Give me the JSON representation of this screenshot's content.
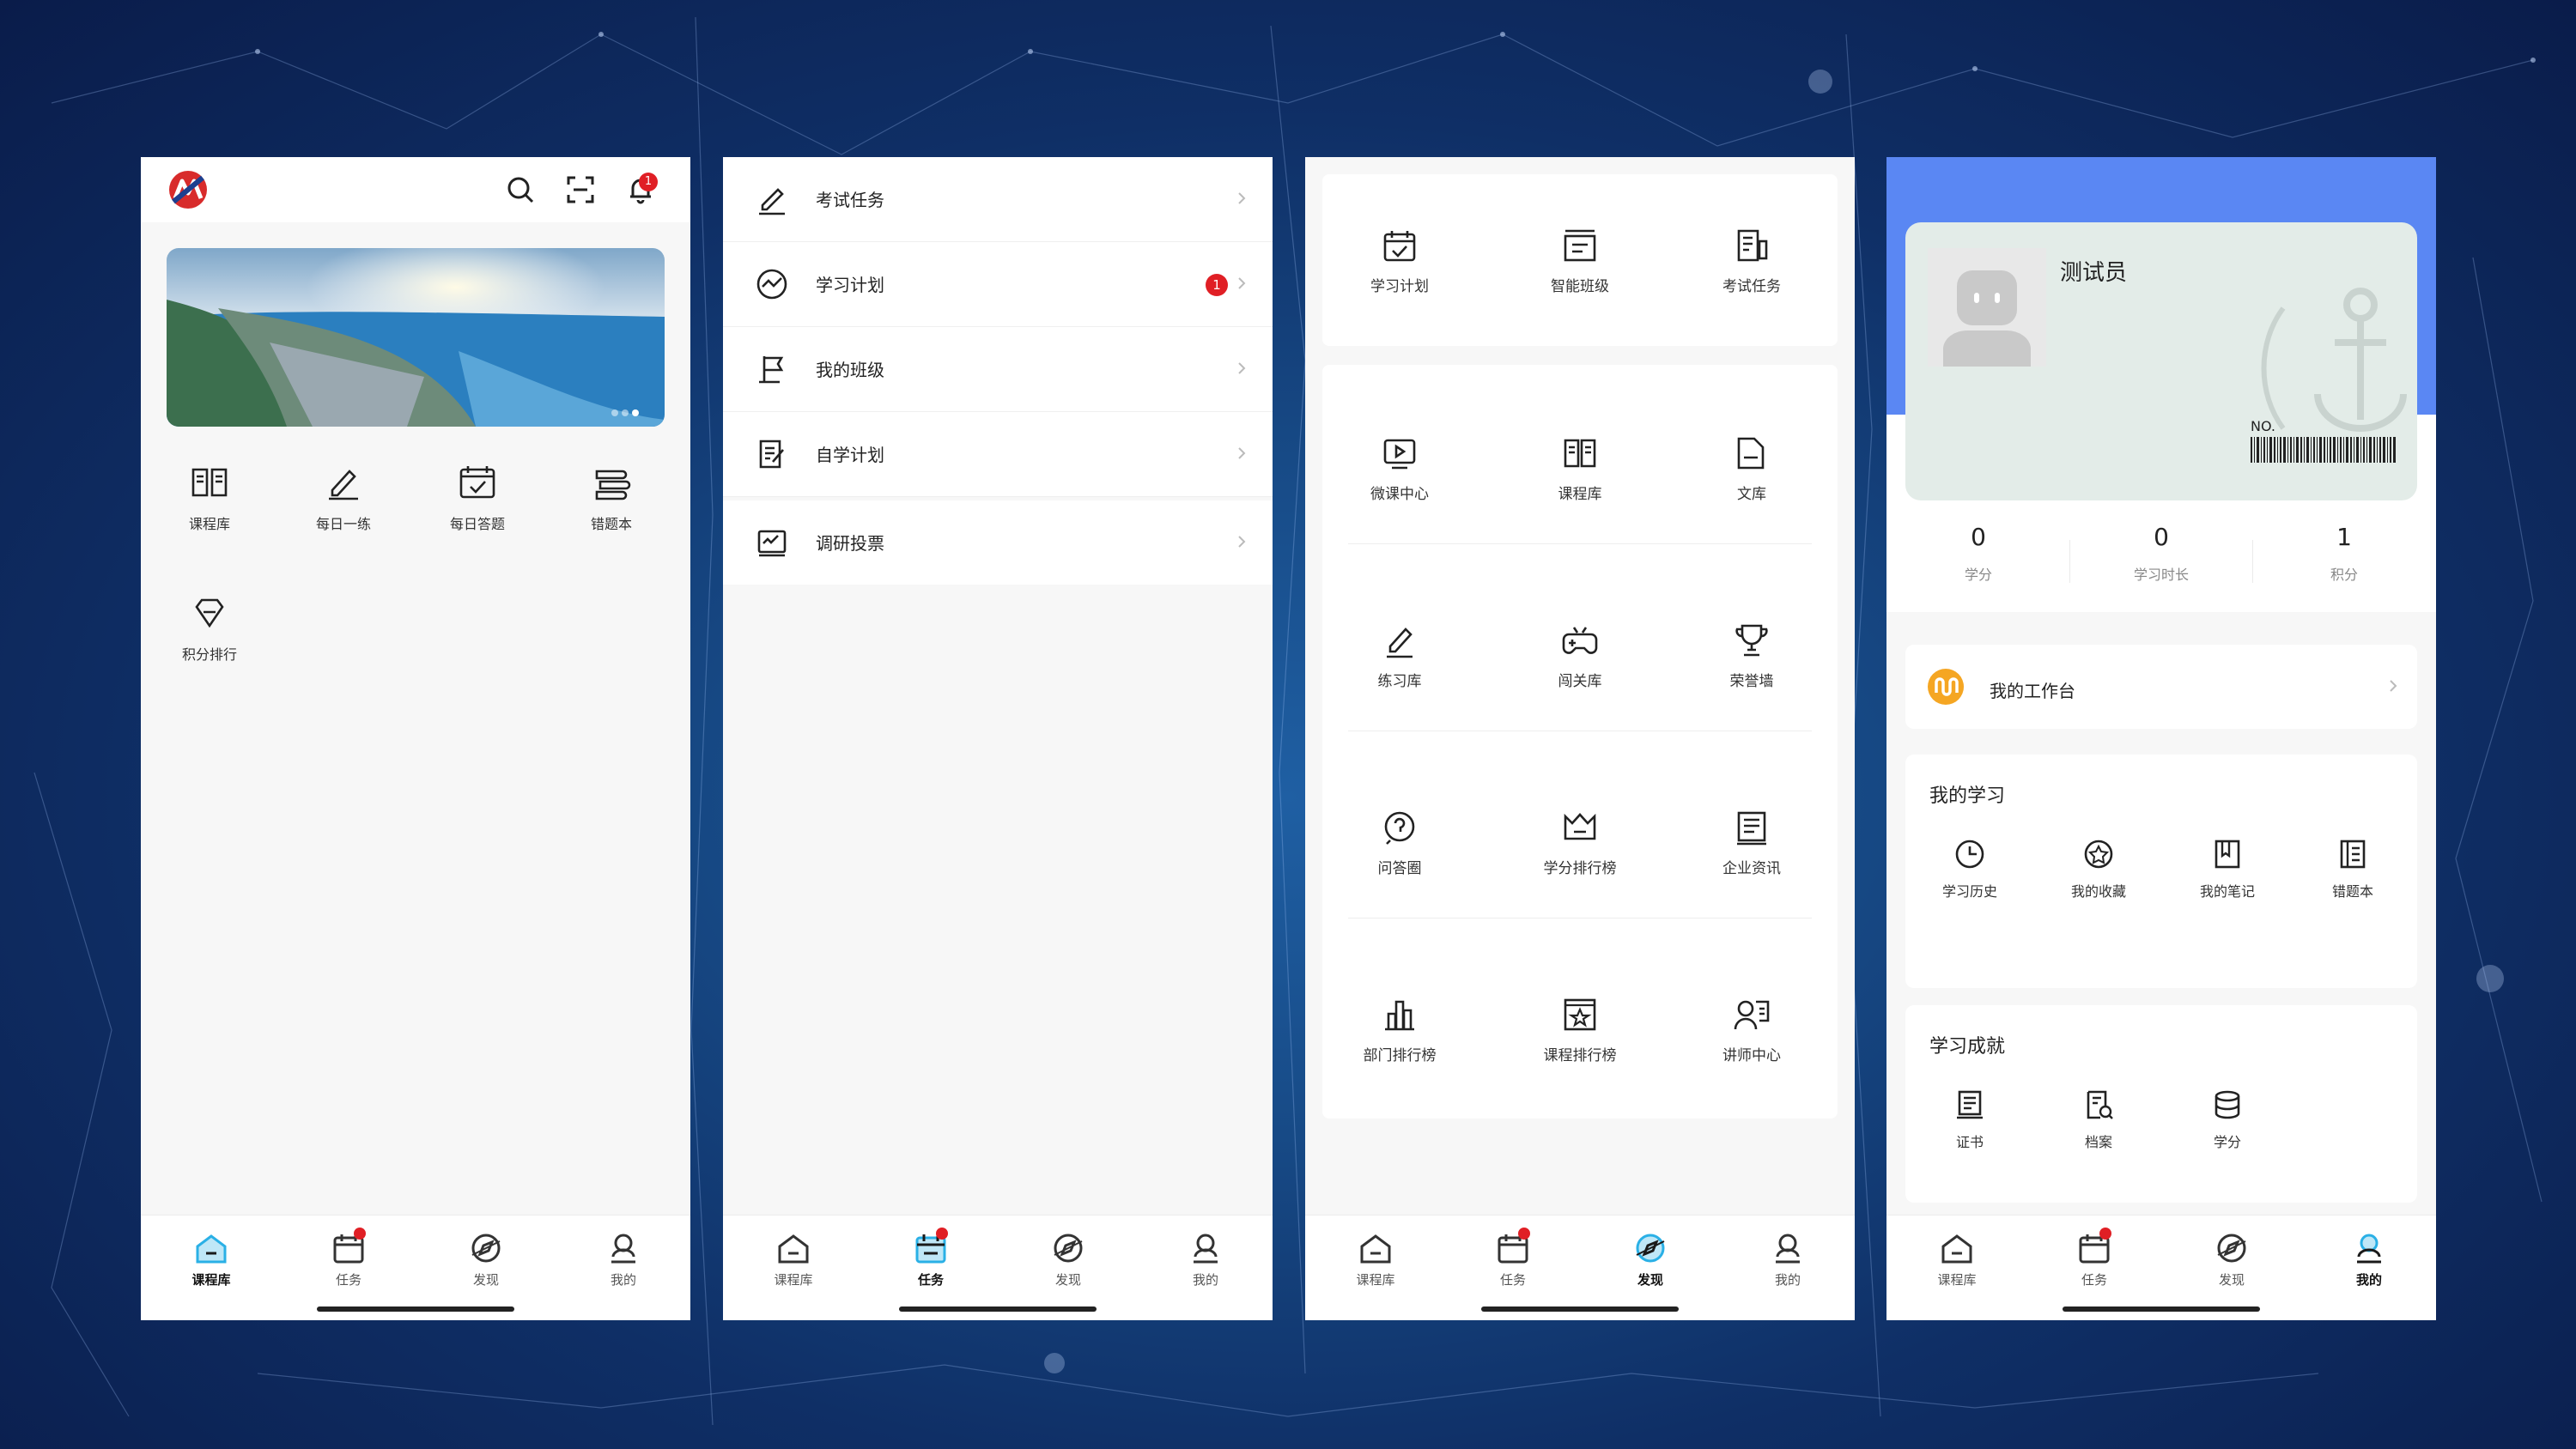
{
  "screen1": {
    "notification_count": "1",
    "grid": [
      {
        "label": "课程库",
        "icon": "book-open-icon"
      },
      {
        "label": "每日一练",
        "icon": "pencil-icon"
      },
      {
        "label": "每日答题",
        "icon": "calendar-check-icon"
      },
      {
        "label": "错题本",
        "icon": "stack-icon"
      },
      {
        "label": "积分排行",
        "icon": "diamond-icon"
      }
    ]
  },
  "screen2": {
    "items": [
      {
        "label": "考试任务",
        "icon": "pencil-icon"
      },
      {
        "label": "学习计划",
        "icon": "trend-icon",
        "badge": "1"
      },
      {
        "label": "我的班级",
        "icon": "flag-icon"
      },
      {
        "label": "自学计划",
        "icon": "document-edit-icon"
      },
      {
        "label": "调研投票",
        "icon": "survey-icon"
      }
    ]
  },
  "screen3": {
    "top": [
      {
        "label": "学习计划",
        "icon": "calendar-check-icon"
      },
      {
        "label": "智能班级",
        "icon": "class-icon"
      },
      {
        "label": "考试任务",
        "icon": "exam-icon"
      }
    ],
    "grid": [
      {
        "label": "微课中心",
        "icon": "video-icon"
      },
      {
        "label": "课程库",
        "icon": "book-open-icon"
      },
      {
        "label": "文库",
        "icon": "folder-icon"
      },
      {
        "label": "练习库",
        "icon": "pencil-icon"
      },
      {
        "label": "闯关库",
        "icon": "gamepad-icon"
      },
      {
        "label": "荣誉墙",
        "icon": "trophy-icon"
      },
      {
        "label": "问答圈",
        "icon": "question-icon"
      },
      {
        "label": "学分排行榜",
        "icon": "crown-icon"
      },
      {
        "label": "企业资讯",
        "icon": "news-icon"
      },
      {
        "label": "部门排行榜",
        "icon": "bar-chart-icon"
      },
      {
        "label": "课程排行榜",
        "icon": "star-frame-icon"
      },
      {
        "label": "讲师中心",
        "icon": "teacher-icon"
      }
    ]
  },
  "screen4": {
    "user_name": "测试员",
    "card_no": "NO.",
    "stats": [
      {
        "value": "0",
        "label": "学分"
      },
      {
        "value": "0",
        "label": "学习时长"
      },
      {
        "value": "1",
        "label": "积分"
      }
    ],
    "workbench_label": "我的工作台",
    "my_learning": {
      "title": "我的学习",
      "items": [
        {
          "label": "学习历史",
          "icon": "clock-icon"
        },
        {
          "label": "我的收藏",
          "icon": "star-circle-icon"
        },
        {
          "label": "我的笔记",
          "icon": "note-icon"
        },
        {
          "label": "错题本",
          "icon": "wrong-book-icon"
        }
      ]
    },
    "achievements": {
      "title": "学习成就",
      "items": [
        {
          "label": "证书",
          "icon": "certificate-icon"
        },
        {
          "label": "档案",
          "icon": "archive-icon"
        },
        {
          "label": "学分",
          "icon": "database-icon"
        }
      ]
    }
  },
  "tabbar": {
    "tabs": [
      {
        "label": "课程库",
        "icon": "home-icon"
      },
      {
        "label": "任务",
        "icon": "calendar-icon"
      },
      {
        "label": "发现",
        "icon": "compass-icon"
      },
      {
        "label": "我的",
        "icon": "user-icon"
      }
    ]
  },
  "colors": {
    "accent": "#5a87f3",
    "badge": "#e01f25",
    "workbench": "#f5a623",
    "tab_active": "#2ab0e6"
  }
}
